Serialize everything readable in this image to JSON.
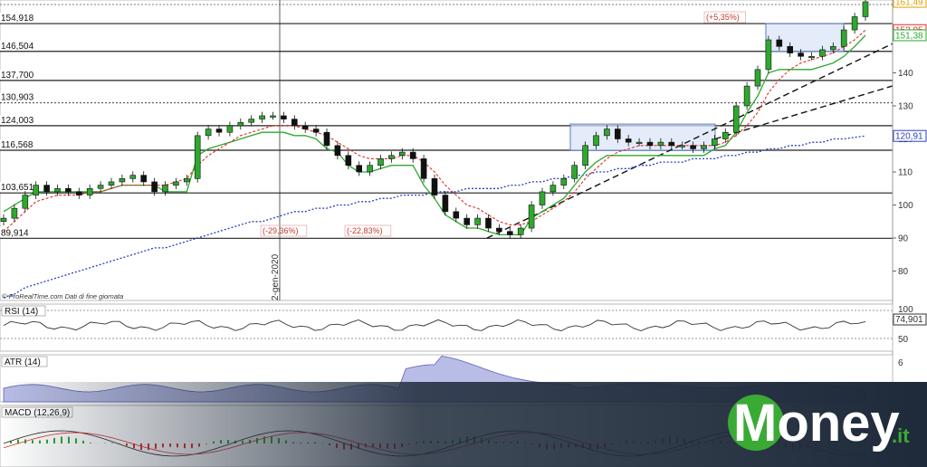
{
  "chart_data": {
    "type": "candlestick",
    "axis": {
      "y_ticks": [
        "140",
        "130",
        "120",
        "110",
        "100",
        "90",
        "80"
      ],
      "ylim": [
        72,
        165
      ]
    },
    "date_label": "2-gen-2020",
    "levels": [
      {
        "label": "154,918",
        "value": 154.918
      },
      {
        "label": "146,504",
        "value": 146.504
      },
      {
        "label": "137,700",
        "value": 137.7
      },
      {
        "label": "130,903",
        "value": 130.903
      },
      {
        "label": "124,003",
        "value": 124.003
      },
      {
        "label": "116,568",
        "value": 116.568
      },
      {
        "label": "103,651",
        "value": 103.651
      },
      {
        "label": "89,914",
        "value": 89.914
      }
    ],
    "price_tags": [
      {
        "label": "161,49",
        "value": 161.49,
        "color": "#e0a000"
      },
      {
        "label": "152,95",
        "value": 152.95,
        "color": "#e0302a"
      },
      {
        "label": "151,38",
        "value": 151.38,
        "color": "#2ea82e"
      },
      {
        "label": "120,91",
        "value": 120.91,
        "color": "#2a3fbf"
      }
    ],
    "pct_annotations": [
      "(-29,36%)",
      "(-22,83%)",
      "(+5,35%)"
    ],
    "close": [
      96,
      99,
      103,
      106,
      104,
      105,
      104,
      103,
      105,
      106,
      107,
      108,
      109,
      107,
      104,
      106,
      107,
      108,
      121,
      123,
      122,
      124,
      125,
      126,
      127,
      127,
      126,
      124,
      123,
      122,
      118,
      115,
      112,
      110,
      112,
      114,
      115,
      116,
      114,
      108,
      103,
      98,
      96,
      94,
      96,
      93,
      92,
      91,
      93,
      100,
      104,
      106,
      108,
      112,
      118,
      121,
      123,
      120,
      119,
      119,
      118,
      119,
      118,
      118,
      117,
      118,
      120,
      122,
      130,
      136,
      141,
      150,
      148,
      146,
      145,
      145,
      147,
      148,
      153,
      157,
      161.5
    ],
    "sma_red": [
      92,
      95,
      98,
      101,
      102,
      103,
      103,
      103,
      104,
      104,
      105,
      106,
      106,
      106,
      106,
      106,
      107,
      108,
      112,
      115,
      117,
      119,
      121,
      122,
      123,
      124,
      124,
      124,
      123,
      122,
      121,
      119,
      117,
      115,
      114,
      114,
      114,
      115,
      115,
      113,
      110,
      106,
      103,
      100,
      99,
      97,
      95,
      94,
      94,
      95,
      97,
      99,
      101,
      104,
      108,
      111,
      114,
      116,
      117,
      118,
      118,
      118,
      118,
      118,
      118,
      118,
      118,
      119,
      121,
      124,
      128,
      134,
      138,
      141,
      143,
      144,
      145,
      146,
      148,
      150,
      152.95
    ],
    "sma_blue": [
      72,
      73,
      75,
      76,
      77,
      78,
      79,
      80,
      81,
      82,
      83,
      84,
      85,
      86,
      87,
      87,
      88,
      89,
      90,
      91,
      92,
      93,
      94,
      95,
      95,
      96,
      97,
      98,
      98,
      99,
      99,
      100,
      100,
      101,
      101,
      102,
      102,
      103,
      103,
      103,
      104,
      104,
      104,
      105,
      105,
      105,
      105,
      106,
      106,
      107,
      107,
      108,
      108,
      109,
      109,
      110,
      110,
      111,
      111,
      112,
      112,
      113,
      113,
      113,
      114,
      114,
      114,
      115,
      115,
      116,
      116,
      117,
      117,
      118,
      118,
      119,
      119,
      120,
      120,
      120.5,
      120.91
    ],
    "support_green": [
      98,
      100,
      102,
      104,
      104,
      104,
      104,
      104,
      104,
      104,
      105,
      106,
      106,
      106,
      106,
      104,
      104,
      104,
      115,
      117,
      118,
      119,
      120,
      121,
      122,
      122,
      122,
      121,
      121,
      120,
      117,
      116,
      112,
      110,
      110,
      111,
      112,
      112,
      112,
      106,
      102,
      97,
      95,
      93,
      93,
      92,
      91,
      91,
      91,
      96,
      98,
      100,
      102,
      106,
      110,
      113,
      115,
      115,
      115,
      115,
      115,
      115,
      115,
      115,
      115,
      115,
      117,
      118,
      122,
      128,
      133,
      140,
      141,
      141,
      141,
      141,
      142,
      143,
      145,
      148,
      151.38
    ],
    "rsi": {
      "label": "RSI (14)",
      "last_label": "74,901",
      "last": 74.901,
      "ticks": [
        "100",
        "50"
      ]
    },
    "atr": {
      "label": "ATR (14)",
      "ticks": [
        "6",
        "4"
      ]
    },
    "macd": {
      "label": "MACD (12,26,9)"
    }
  },
  "credit": "© ProRealTime.com  Dati di fine giornata",
  "logo": {
    "text": "Money",
    "suffix": ".it",
    "color": "#3aaa35"
  }
}
